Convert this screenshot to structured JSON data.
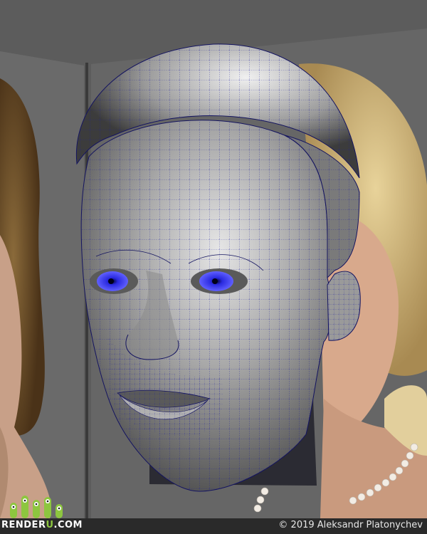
{
  "logo": {
    "text_main": "RENDER",
    "text_accent": "U",
    "text_suffix": ".COM",
    "icon": "renderu-characters-icon"
  },
  "footer": {
    "copyright": "© 2019 Aleksandr Platonychev"
  },
  "colors": {
    "brand_green": "#8dc63f",
    "wireframe_blue": "#1a1aa0",
    "eye_blue": "#2a2ae0",
    "background": "#5c5c5c"
  }
}
